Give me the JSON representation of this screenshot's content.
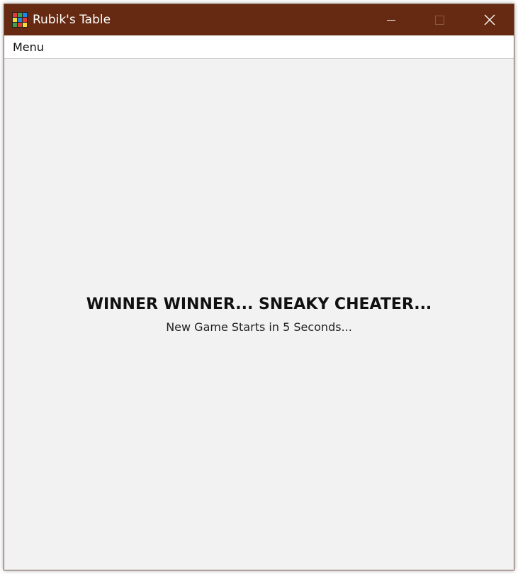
{
  "window": {
    "title": "Rubik's Table",
    "titlebar_color": "#662a12",
    "icon": "rubiks-cube-icon",
    "icon_colors": [
      "#e53935",
      "#43a047",
      "#1e88e5",
      "#fdd835",
      "#1e88e5",
      "#e53935",
      "#43a047",
      "#e53935",
      "#fdd835"
    ],
    "controls": {
      "minimize_icon": "minimize-icon",
      "maximize_icon": "maximize-icon",
      "close_icon": "close-icon"
    }
  },
  "menubar": {
    "items": [
      {
        "label": "Menu"
      }
    ]
  },
  "main": {
    "headline": "WINNER WINNER... SNEAKY CHEATER...",
    "subline": "New Game Starts in 5 Seconds..."
  }
}
